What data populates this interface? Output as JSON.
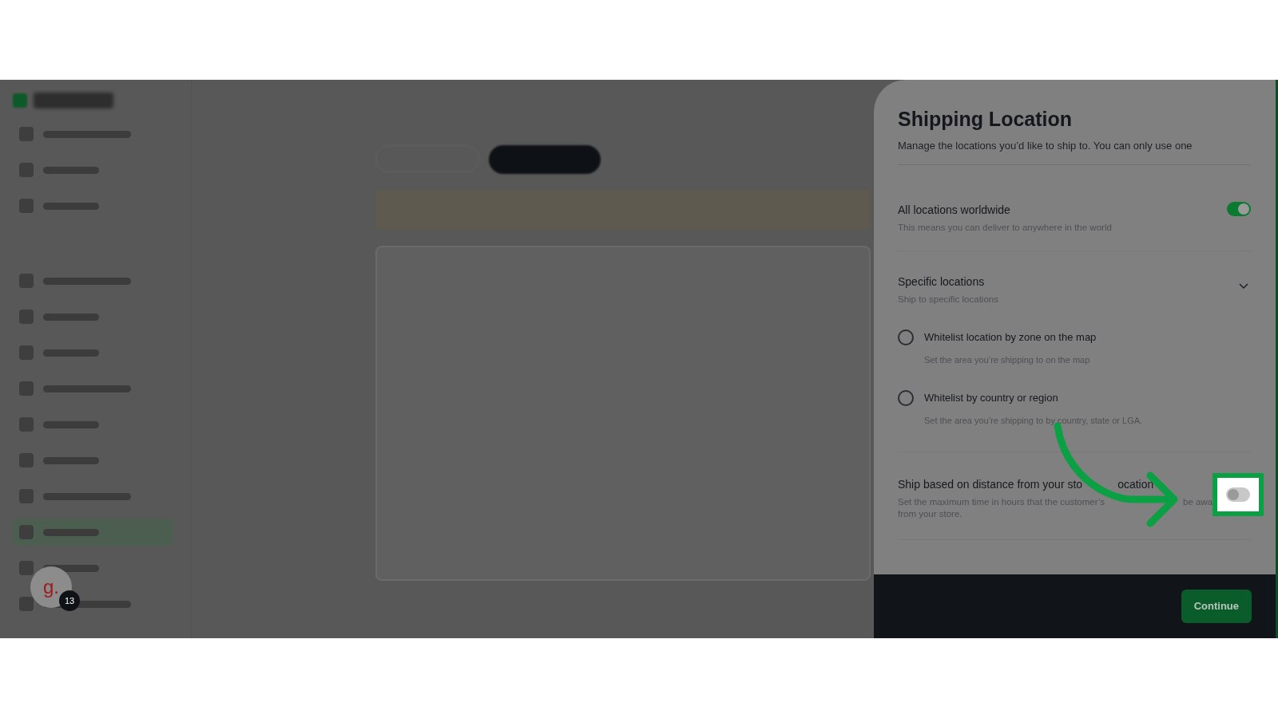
{
  "panel": {
    "title": "Shipping Location",
    "description": "Manage the locations you’d like to ship to. You can only use one",
    "options": [
      {
        "kind": "toggle",
        "title": "All locations worldwide",
        "description": "This means you can deliver to anywhere in the world",
        "on": true,
        "highlighted": false
      },
      {
        "kind": "expandable",
        "title": "Specific locations",
        "description": "Ship to specific locations",
        "expanded": true,
        "choices": [
          {
            "label": "Whitelist location by zone on the map",
            "description": "Set the area you’re shipping to on the map",
            "selected": false
          },
          {
            "label": "Whitelist by country or region",
            "description": "Set the area you’re shipping to by country, state or LGA.",
            "selected": false
          }
        ]
      },
      {
        "kind": "toggle",
        "title_parts": [
          "Ship based on distance from your sto",
          "ocation"
        ],
        "description_lines": [
          [
            "Set the maximum time in hours that the customer’s",
            "be awa"
          ],
          [
            "from your store."
          ]
        ],
        "on": false,
        "highlighted": true
      }
    ]
  },
  "footer": {
    "button": "Continue"
  },
  "avatar": {
    "initial": "g.",
    "badge": "13"
  }
}
